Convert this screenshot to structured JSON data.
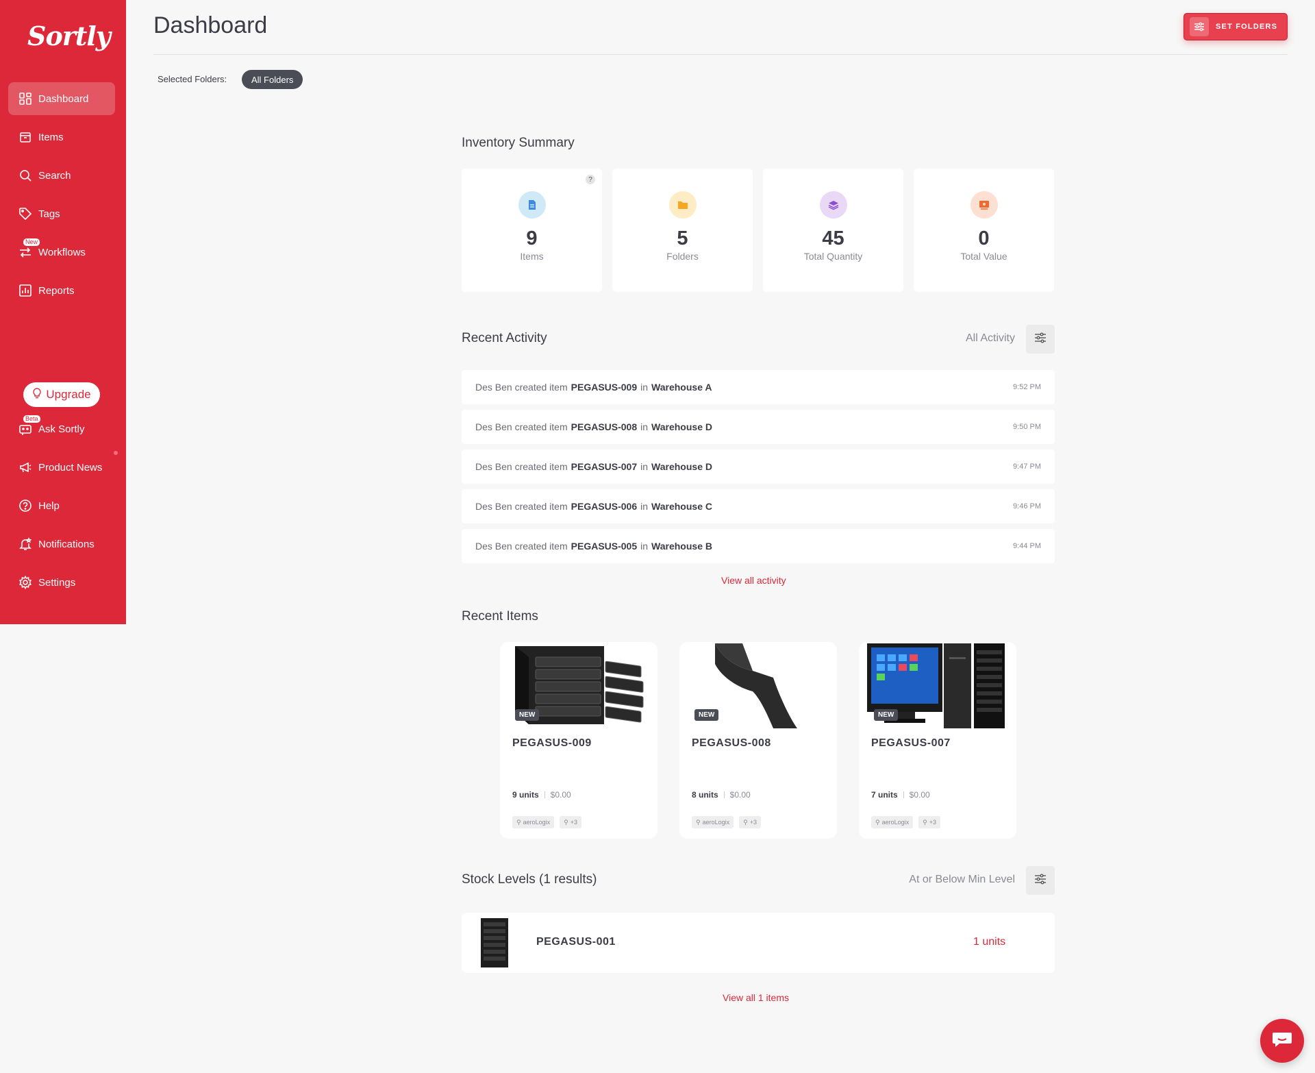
{
  "brand": {
    "logo_text": "Sortly",
    "accent": "#dc2838"
  },
  "sidebar": {
    "items": [
      {
        "label": "Dashboard",
        "icon": "dashboard-icon"
      },
      {
        "label": "Items",
        "icon": "items-icon"
      },
      {
        "label": "Search",
        "icon": "search-icon"
      },
      {
        "label": "Tags",
        "icon": "tag-icon"
      },
      {
        "label": "Workflows",
        "icon": "workflow-icon",
        "badge": "New"
      },
      {
        "label": "Reports",
        "icon": "reports-icon"
      }
    ],
    "upgrade_label": "Upgrade",
    "bottom_items": [
      {
        "label": "Ask Sortly",
        "icon": "chat-bot-icon",
        "badge": "Beta"
      },
      {
        "label": "Product News",
        "icon": "megaphone-icon"
      },
      {
        "label": "Help",
        "icon": "help-icon"
      },
      {
        "label": "Notifications",
        "icon": "bell-icon"
      },
      {
        "label": "Settings",
        "icon": "gear-icon"
      }
    ]
  },
  "header": {
    "title": "Dashboard",
    "set_folders_label": "SET FOLDERS",
    "selected_folders_label": "Selected Folders:",
    "selected_folder": "All Folders"
  },
  "inventory_summary": {
    "title": "Inventory Summary",
    "help": "?",
    "cards": [
      {
        "value": "9",
        "label": "Items",
        "icon": "document-icon"
      },
      {
        "value": "5",
        "label": "Folders",
        "icon": "folder-icon"
      },
      {
        "value": "45",
        "label": "Total Quantity",
        "icon": "layers-icon"
      },
      {
        "value": "0",
        "label": "Total Value",
        "icon": "value-icon"
      }
    ]
  },
  "recent_activity": {
    "title": "Recent Activity",
    "filter_label": "All Activity",
    "rows": [
      {
        "user": "Des Ben",
        "action": "created item",
        "item": "PEGASUS-009",
        "prep": "in",
        "folder": "Warehouse A",
        "time": "9:52 PM"
      },
      {
        "user": "Des Ben",
        "action": "created item",
        "item": "PEGASUS-008",
        "prep": "in",
        "folder": "Warehouse D",
        "time": "9:50 PM"
      },
      {
        "user": "Des Ben",
        "action": "created item",
        "item": "PEGASUS-007",
        "prep": "in",
        "folder": "Warehouse D",
        "time": "9:47 PM"
      },
      {
        "user": "Des Ben",
        "action": "created item",
        "item": "PEGASUS-006",
        "prep": "in",
        "folder": "Warehouse C",
        "time": "9:46 PM"
      },
      {
        "user": "Des Ben",
        "action": "created item",
        "item": "PEGASUS-005",
        "prep": "in",
        "folder": "Warehouse B",
        "time": "9:44 PM"
      }
    ],
    "view_all_label": "View all activity"
  },
  "recent_items": {
    "title": "Recent Items",
    "items": [
      {
        "badge": "NEW",
        "name": "PEGASUS-009",
        "units": "9 units",
        "price": "$0.00",
        "tag": "aeroLogix",
        "more_tags": "+3"
      },
      {
        "badge": "NEW",
        "name": "PEGASUS-008",
        "units": "8 units",
        "price": "$0.00",
        "tag": "aeroLogix",
        "more_tags": "+3"
      },
      {
        "badge": "NEW",
        "name": "PEGASUS-007",
        "units": "7 units",
        "price": "$0.00",
        "tag": "aeroLogix",
        "more_tags": "+3"
      }
    ]
  },
  "stock_levels": {
    "title": "Stock Levels (1 results)",
    "filter_label": "At or Below Min Level",
    "rows": [
      {
        "name": "PEGASUS-001",
        "qty": "1 units"
      }
    ],
    "view_all_label": "View all 1 items"
  }
}
